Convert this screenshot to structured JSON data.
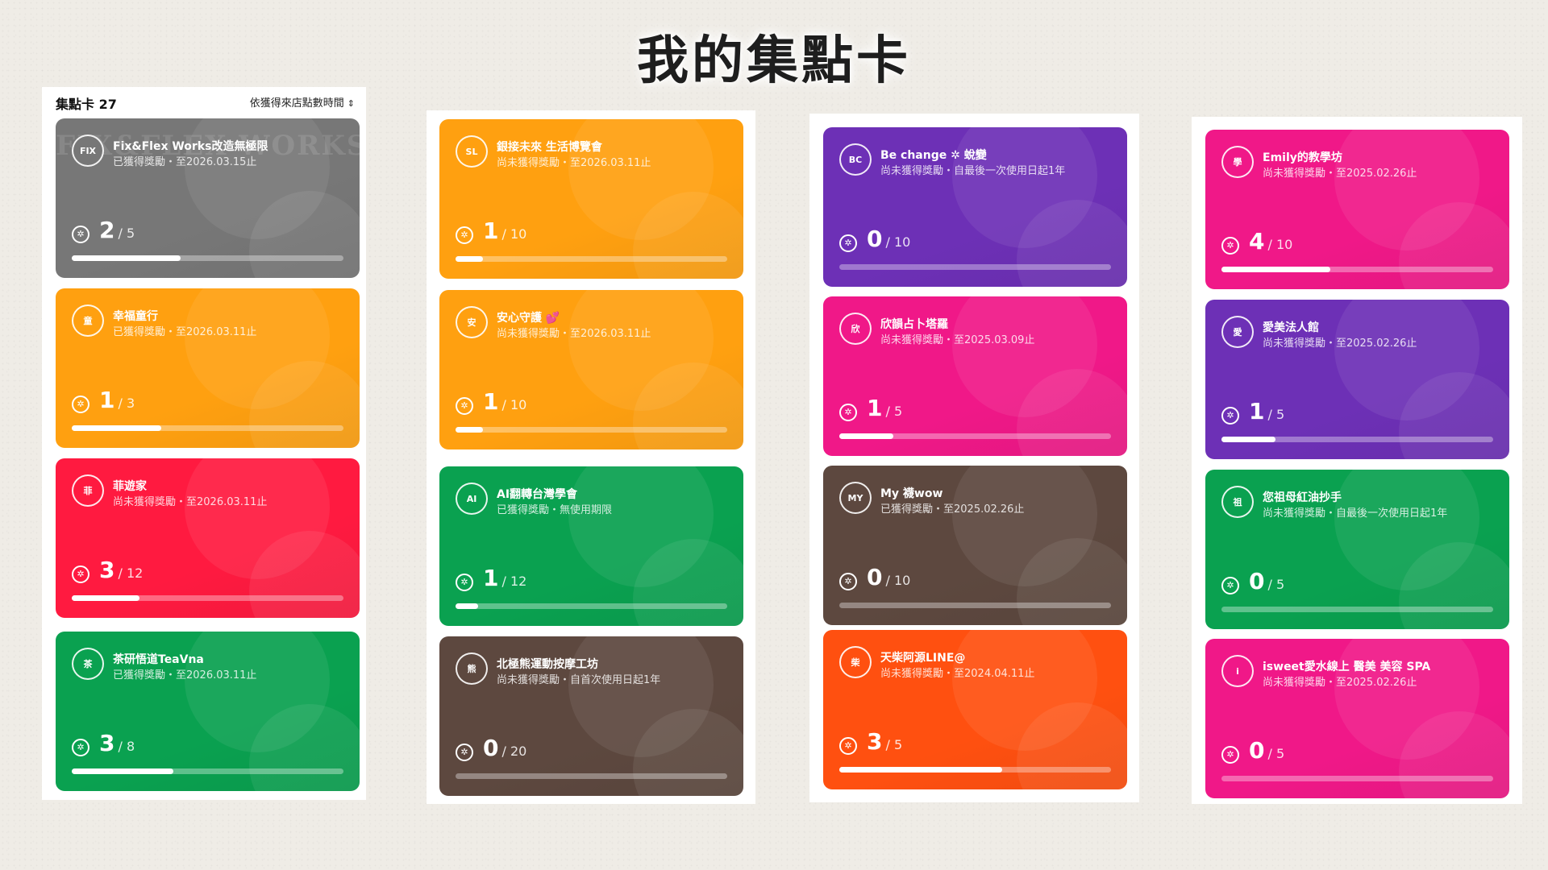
{
  "title": "我的集點卡",
  "header": {
    "count_label": "集點卡 27",
    "sort_label": "依獲得來店點數時間"
  },
  "colors": {
    "gray": "#777777",
    "orange": "#ffa010",
    "red": "#ff1a40",
    "green": "#0aa150",
    "purple": "#6d30b6",
    "pink": "#f01888",
    "brown": "#5d483f",
    "deeporange": "#ff5010"
  },
  "columns": [
    {
      "cards": [
        {
          "name": "Fix&Flex Works改造無極限",
          "sub": "已獲得獎勵・至2026.03.15止",
          "current": "2",
          "total": "/ 5",
          "progress": 0.4,
          "color": "gray",
          "avatar": "FIX",
          "watermark": "FIX&FLEX WORKS"
        },
        {
          "name": "幸福童行",
          "sub": "已獲得獎勵・至2026.03.11止",
          "current": "1",
          "total": "/ 3",
          "progress": 0.33,
          "color": "orange",
          "avatar": "童"
        },
        {
          "name": "菲遊家",
          "sub": "尚未獲得獎勵・至2026.03.11止",
          "current": "3",
          "total": "/ 12",
          "progress": 0.25,
          "color": "red",
          "avatar": "菲"
        },
        {
          "name": "茶研悟道TeaVna",
          "sub": "已獲得獎勵・至2026.03.11止",
          "current": "3",
          "total": "/ 8",
          "progress": 0.375,
          "color": "green",
          "avatar": "茶"
        }
      ]
    },
    {
      "cards": [
        {
          "name": "銀接未來 生活博覽會",
          "sub": "尚未獲得獎勵・至2026.03.11止",
          "current": "1",
          "total": "/ 10",
          "progress": 0.1,
          "color": "orange",
          "avatar": "SL"
        },
        {
          "name": "安心守護 💕",
          "sub": "尚未獲得獎勵・至2026.03.11止",
          "current": "1",
          "total": "/ 10",
          "progress": 0.1,
          "color": "orange",
          "avatar": "安"
        },
        {
          "name": "AI翻轉台灣學會",
          "sub": "已獲得獎勵・無使用期限",
          "current": "1",
          "total": "/ 12",
          "progress": 0.083,
          "color": "green",
          "avatar": "AI"
        },
        {
          "name": "北極熊運動按摩工坊",
          "sub": "尚未獲得獎勵・自首次使用日起1年",
          "current": "0",
          "total": "/ 20",
          "progress": 0,
          "color": "brown",
          "avatar": "熊"
        }
      ]
    },
    {
      "cards": [
        {
          "name": "Be change ✲ 蛻變",
          "sub": "尚未獲得獎勵・自最後一次使用日起1年",
          "current": "0",
          "total": "/ 10",
          "progress": 0,
          "color": "purple",
          "avatar": "BC"
        },
        {
          "name": "欣韻占卜塔羅",
          "sub": "尚未獲得獎勵・至2025.03.09止",
          "current": "1",
          "total": "/ 5",
          "progress": 0.2,
          "color": "pink",
          "avatar": "欣"
        },
        {
          "name": "My 襪wow",
          "sub": "已獲得獎勵・至2025.02.26止",
          "current": "0",
          "total": "/ 10",
          "progress": 0,
          "color": "brown",
          "avatar": "MY"
        },
        {
          "name": "天柴阿源LINE@",
          "sub": "尚未獲得獎勵・至2024.04.11止",
          "current": "3",
          "total": "/ 5",
          "progress": 0.6,
          "color": "deeporange",
          "avatar": "柴"
        }
      ]
    },
    {
      "cards": [
        {
          "name": "Emily的教學坊",
          "sub": "尚未獲得獎勵・至2025.02.26止",
          "current": "4",
          "total": "/ 10",
          "progress": 0.4,
          "color": "pink",
          "avatar": "學"
        },
        {
          "name": "愛美法人館",
          "sub": "尚未獲得獎勵・至2025.02.26止",
          "current": "1",
          "total": "/ 5",
          "progress": 0.2,
          "color": "purple",
          "avatar": "愛"
        },
        {
          "name": "您祖母紅油抄手",
          "sub": "尚未獲得獎勵・自最後一次使用日起1年",
          "current": "0",
          "total": "/ 5",
          "progress": 0,
          "color": "green",
          "avatar": "祖"
        },
        {
          "name": "isweet愛水線上 醫美 美容 SPA",
          "sub": "尚未獲得獎勵・至2025.02.26止",
          "current": "0",
          "total": "/ 5",
          "progress": 0,
          "color": "pink",
          "avatar": "i"
        }
      ]
    }
  ]
}
